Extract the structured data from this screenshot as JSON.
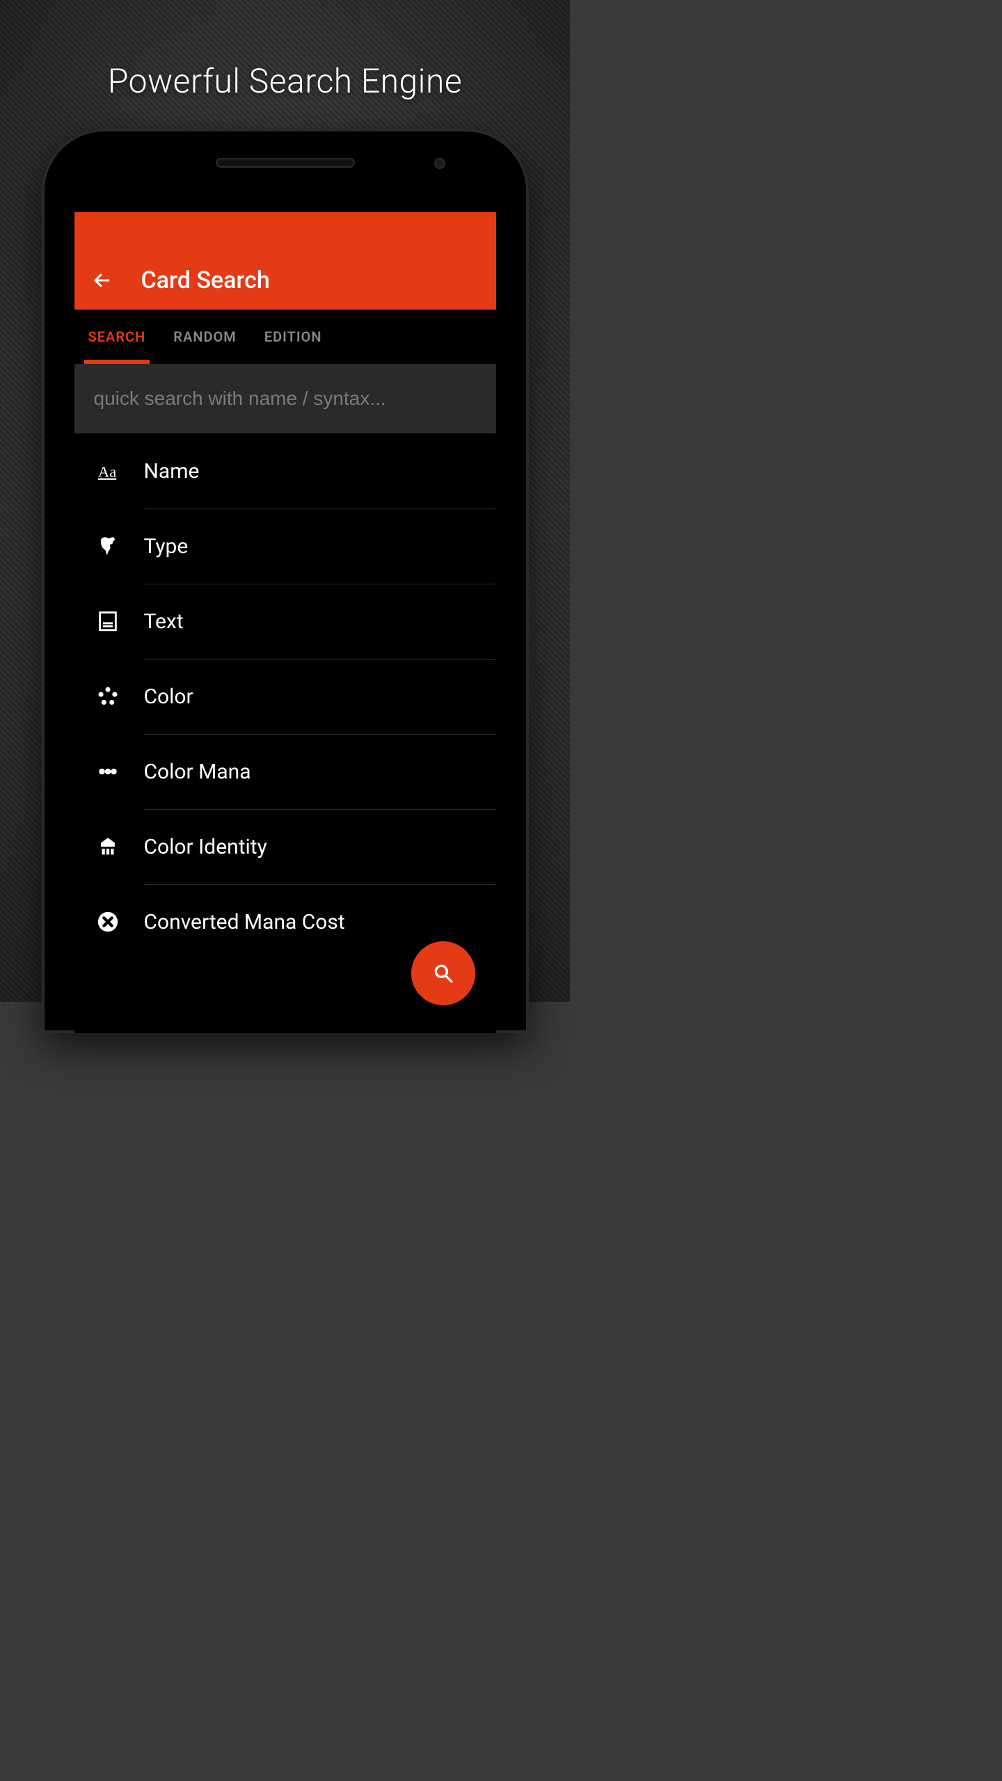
{
  "headline": "Powerful Search Engine",
  "appBar": {
    "title": "Card Search"
  },
  "tabs": [
    {
      "label": "SEARCH",
      "active": true
    },
    {
      "label": "RANDOM",
      "active": false
    },
    {
      "label": "EDITION",
      "active": false
    }
  ],
  "search": {
    "placeholder": "quick search with name / syntax..."
  },
  "criteria": [
    {
      "icon": "name-icon",
      "label": "Name"
    },
    {
      "icon": "type-icon",
      "label": "Type"
    },
    {
      "icon": "text-icon",
      "label": "Text"
    },
    {
      "icon": "color-icon",
      "label": "Color"
    },
    {
      "icon": "color-mana-icon",
      "label": "Color Mana"
    },
    {
      "icon": "color-identity-icon",
      "label": "Color Identity"
    },
    {
      "icon": "cmc-icon",
      "label": "Converted Mana Cost"
    }
  ],
  "colors": {
    "accent": "#e43a15",
    "bg": "#000000"
  }
}
